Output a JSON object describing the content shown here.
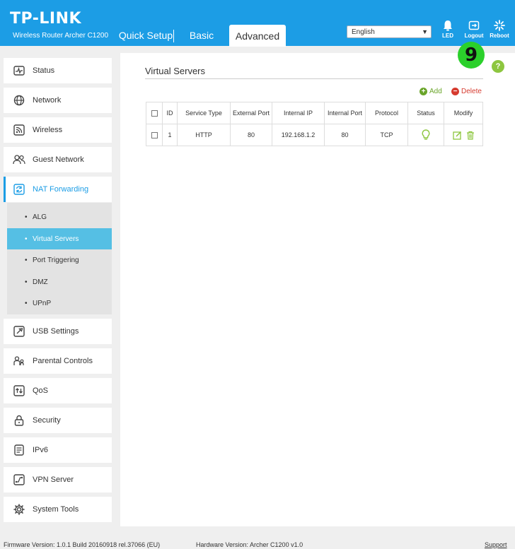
{
  "header": {
    "brand": "TP-LINK",
    "model": "Wireless Router Archer C1200",
    "tabs": {
      "quick_setup": "Quick Setup",
      "basic": "Basic",
      "advanced": "Advanced"
    },
    "language": "English",
    "led": "LED",
    "logout": "Logout",
    "reboot": "Reboot"
  },
  "sidebar": {
    "items": {
      "status": "Status",
      "network": "Network",
      "wireless": "Wireless",
      "guest": "Guest Network",
      "nat": "NAT Forwarding",
      "usb": "USB Settings",
      "parental": "Parental Controls",
      "qos": "QoS",
      "security": "Security",
      "ipv6": "IPv6",
      "vpn": "VPN Server",
      "system": "System Tools"
    },
    "submenu": {
      "alg": "ALG",
      "virtual_servers": "Virtual Servers",
      "port_triggering": "Port Triggering",
      "dmz": "DMZ",
      "upnp": "UPnP"
    }
  },
  "main": {
    "title": "Virtual Servers",
    "step_badge": "9",
    "help": "?",
    "add_label": "Add",
    "delete_label": "Delete",
    "columns": {
      "id": "ID",
      "service_type": "Service Type",
      "external_port": "External Port",
      "internal_ip": "Internal IP",
      "internal_port": "Internal Port",
      "protocol": "Protocol",
      "status": "Status",
      "modify": "Modify"
    },
    "rows": [
      {
        "id": "1",
        "service_type": "HTTP",
        "external_port": "80",
        "internal_ip": "192.168.1.2",
        "internal_port": "80",
        "protocol": "TCP"
      }
    ]
  },
  "footer": {
    "firmware": "Firmware Version: 1.0.1 Build 20160918 rel.37066 (EU)",
    "hardware": "Hardware Version: Archer C1200 v1.0",
    "support": "Support"
  },
  "colors": {
    "header_blue": "#1c9de5",
    "submenu_active": "#55bfe4",
    "green": "#8dc63f",
    "delete_red": "#d63b2f"
  }
}
